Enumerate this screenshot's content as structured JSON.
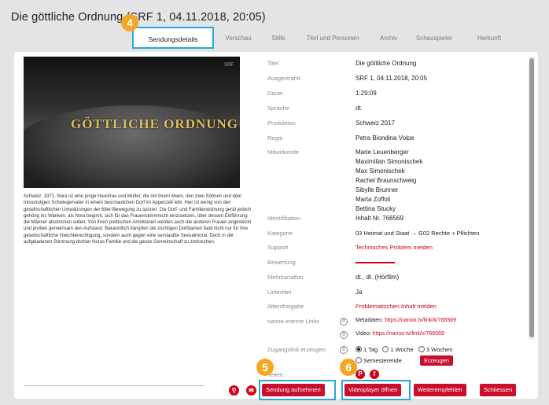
{
  "window": {
    "title": "Die göttliche Ordnung (SRF 1, 04.11.2018, 20:05)"
  },
  "tabs": [
    {
      "label": "Sendungsdetails"
    },
    {
      "label": "Vorschau"
    },
    {
      "label": "Stills"
    },
    {
      "label": "Titel und Personen"
    },
    {
      "label": "Archiv"
    },
    {
      "label": "Schauspieler"
    },
    {
      "label": "Herkunft"
    }
  ],
  "video": {
    "title_overlay": "GÖTTLICHE ORDNUNG",
    "badge": "SRF"
  },
  "description": "Schweiz, 1971. Nora ist eine junge Hausfrau und Mutter, die mit ihrem Mann, den zwei Söhnen und dem missmutigen Schwiegervater in einem beschaulichen Dorf im Appenzell lebt. Hier ist wenig von den gesellschaftlichen Umwälzungen der 68er-Bewegung zu spüren. Die Dorf- und Familienordnung gerät jedoch gehörig ins Wanken, als Nora beginnt, sich für das Frauenstimmrecht einzusetzen, über dessen Einführung die Männer abstimmen sollen. Von ihren politischen Ambitionen werden auch die anderen Frauen angesteckt und proben gemeinsam den Aufstand. Bekanntlich kämpfen die züchtigen Dorfdamen bald nicht nur für ihre gesellschaftliche Gleichberechtigung, sondern auch gegen eine verstaubte Sexualmoral. Doch in der aufgeladenen Stimmung drohen Noras Familie und die ganze Gemeinschaft zu zerbrechen.",
  "meta": {
    "titel": {
      "label": "Titel",
      "value": "Die göttliche Ordnung"
    },
    "ausgestrahlt": {
      "label": "Ausgestrahlt",
      "value": "SRF 1, 04.11.2018, 20:05"
    },
    "dauer": {
      "label": "Dauer",
      "value": "1:29:09"
    },
    "sprache": {
      "label": "Sprache",
      "value": "dt."
    },
    "produktion": {
      "label": "Produktion",
      "value": "Schweiz 2017"
    },
    "regie": {
      "label": "Regie",
      "value": "Petra Biondina Volpe"
    },
    "mitwirkende": {
      "label": "Mitwirkende",
      "values": [
        "Marie Leuenberger",
        "Maximilian Simonischek",
        "Max Simonischek",
        "Rachel Braunschweig",
        "Sibylle Brunner",
        "Marta Zoffoli",
        "Bettina Stucky"
      ]
    },
    "identifikation": {
      "label": "Identifikation",
      "value": "Inhalt Nr. 766569"
    },
    "kategorie": {
      "label": "Kategorie",
      "value": "03 Heimat und Staat → G02 Rechte + Pflichten"
    },
    "support": {
      "label": "Support",
      "value": "Technisches Problem melden"
    },
    "bewertung": {
      "label": "Bewertung"
    },
    "mehrkanalton": {
      "label": "Mehrkanalton",
      "value": "dt., dt. (Hörfilm)"
    },
    "untertitel": {
      "label": "Untertitel",
      "value": "Ja"
    },
    "altersfreigabe": {
      "label": "Altersfreigabe",
      "value": "Problematischen Inhalt melden"
    },
    "links": {
      "label": "nanoo-interne Links",
      "metadaten_prefix": "Metadaten: ",
      "metadaten_url": "https://nanoo.tv/link/k/766569",
      "video_prefix": "Video: ",
      "video_url": "https://nanoo.tv/link/v/766569"
    },
    "zugangslink": {
      "label": "Zugangslink erzeugen",
      "options": [
        "1 Tag",
        "1 Woche",
        "3 Wochen",
        "Semesterende"
      ],
      "button": "Erzeugen"
    },
    "teilen": {
      "label": "Teilen:"
    }
  },
  "actions": {
    "record": "Sendung aufnehmen",
    "player": "Videoplayer öffnen",
    "recommend": "Weiterempfehlen",
    "close": "Schliessen"
  },
  "callouts": {
    "c4": "4",
    "c5": "5",
    "c6": "6"
  },
  "colors": {
    "accent_red": "#c8102e",
    "callout_orange": "#f5a623",
    "highlight_blue": "#29a8e0"
  }
}
